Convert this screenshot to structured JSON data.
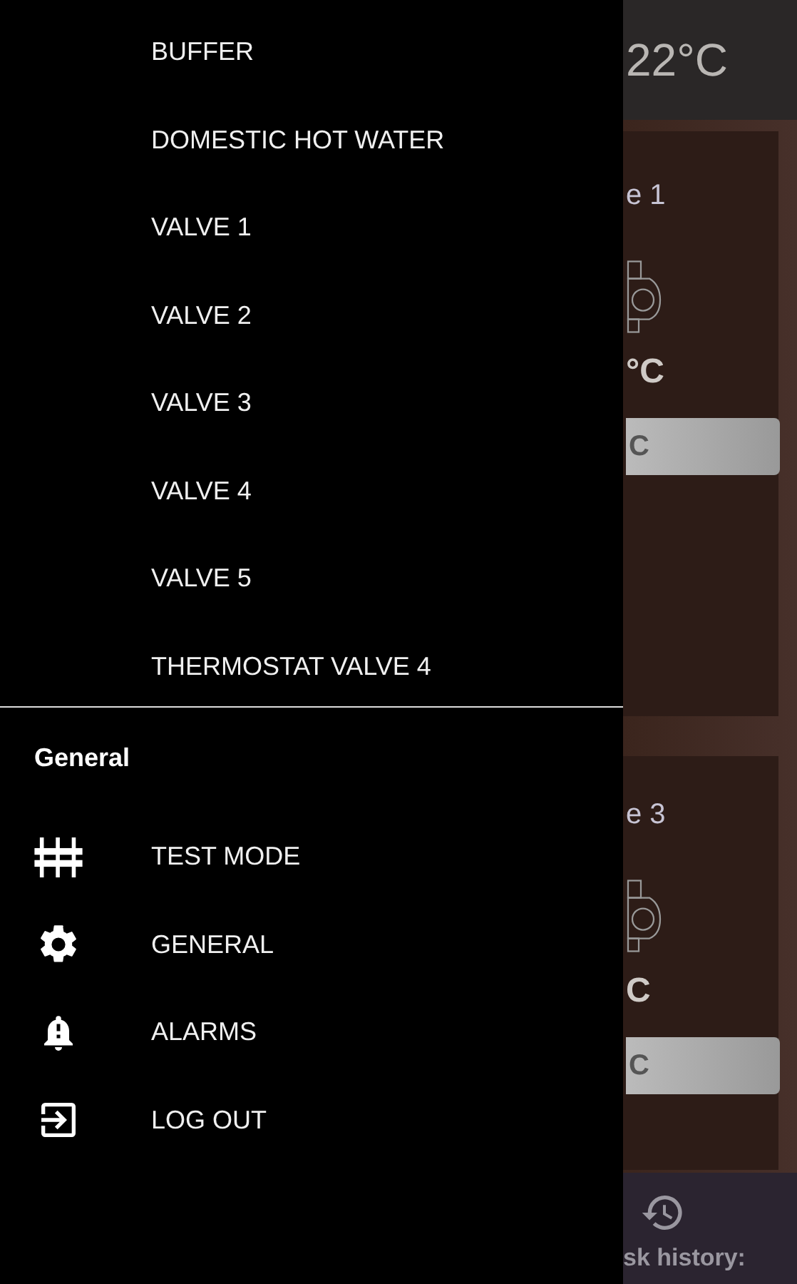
{
  "background": {
    "temperature": "22°C",
    "cards": [
      {
        "title": "e 1",
        "reading": "°C",
        "button": "C"
      },
      {
        "title": "e 3",
        "reading": "C",
        "button": "C"
      }
    ],
    "bottom_bar": {
      "label": "sk history:"
    }
  },
  "drawer": {
    "items": [
      {
        "label": "BUFFER"
      },
      {
        "label": "DOMESTIC HOT WATER"
      },
      {
        "label": "VALVE 1"
      },
      {
        "label": "VALVE 2"
      },
      {
        "label": "VALVE 3"
      },
      {
        "label": "VALVE 4"
      },
      {
        "label": "VALVE 5"
      },
      {
        "label": "THERMOSTAT VALVE 4"
      }
    ],
    "section": {
      "title": "General",
      "items": [
        {
          "label": "TEST MODE",
          "kind": "test"
        },
        {
          "label": "GENERAL",
          "kind": "settings"
        },
        {
          "label": "ALARMS",
          "kind": "alarms"
        },
        {
          "label": "LOG OUT",
          "kind": "logout"
        }
      ]
    }
  }
}
